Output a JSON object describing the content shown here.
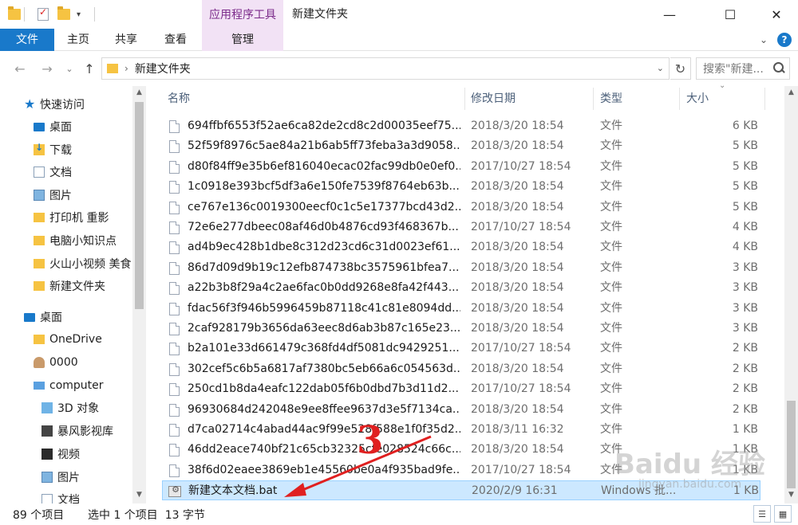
{
  "titlebar": {
    "context_tab": "应用程序工具",
    "window_title": "新建文件夹",
    "minimize": "—",
    "maximize": "☐",
    "close": "✕"
  },
  "ribbon": {
    "tabs": [
      "文件",
      "主页",
      "共享",
      "查看",
      "管理"
    ],
    "collapse": "⌄",
    "help": "?"
  },
  "address": {
    "back": "←",
    "forward": "→",
    "recent": "⌄",
    "up": "↑",
    "separator": "›",
    "path": "新建文件夹",
    "refresh": "↻",
    "search_placeholder": "搜索\"新建..."
  },
  "nav": {
    "items": [
      {
        "label": "快速访问",
        "icon": "star-icon"
      },
      {
        "label": "桌面",
        "icon": "desktop-folder-icon",
        "pinned": true
      },
      {
        "label": "下载",
        "icon": "download-icon",
        "pinned": true
      },
      {
        "label": "文档",
        "icon": "document-icon",
        "pinned": true
      },
      {
        "label": "图片",
        "icon": "picture-icon",
        "pinned": true
      },
      {
        "label": "打印机 重影",
        "icon": "folder-icon"
      },
      {
        "label": "电脑小知识点",
        "icon": "folder-icon"
      },
      {
        "label": "火山小视频 美食",
        "icon": "folder-icon"
      },
      {
        "label": "新建文件夹",
        "icon": "folder-icon"
      },
      {
        "label": "桌面",
        "icon": "desktop-icon"
      },
      {
        "label": "OneDrive",
        "icon": "onedrive-folder-icon"
      },
      {
        "label": "0000",
        "icon": "user-icon"
      },
      {
        "label": "computer",
        "icon": "computer-icon"
      },
      {
        "label": "3D 对象",
        "icon": "3d-objects-icon"
      },
      {
        "label": "暴风影视库",
        "icon": "video-library-icon"
      },
      {
        "label": "视频",
        "icon": "video-icon"
      },
      {
        "label": "图片",
        "icon": "picture-icon"
      },
      {
        "label": "文档",
        "icon": "document-icon"
      }
    ]
  },
  "columns": {
    "name": "名称",
    "date": "修改日期",
    "type": "类型",
    "size": "大小"
  },
  "files": [
    {
      "name": "694ffbf6553f52ae6ca82de2cd8c2d00035eef75...",
      "date": "2018/3/20 18:54",
      "type": "文件",
      "size": "6 KB"
    },
    {
      "name": "52f59f8976c5ae84a21b6ab5ff73feba3a3d9058...",
      "date": "2018/3/20 18:54",
      "type": "文件",
      "size": "5 KB"
    },
    {
      "name": "d80f84ff9e35b6ef816040ecac02fac99db0e0ef0...",
      "date": "2017/10/27 18:54",
      "type": "文件",
      "size": "5 KB"
    },
    {
      "name": "1c0918e393bcf5df3a6e150fe7539f8764eb63b...",
      "date": "2018/3/20 18:54",
      "type": "文件",
      "size": "5 KB"
    },
    {
      "name": "ce767e136c0019300eecf0c1c5e17377bcd43d2...",
      "date": "2018/3/20 18:54",
      "type": "文件",
      "size": "5 KB"
    },
    {
      "name": "72e6e277dbeec08af46d0b4876cd93f468367b...",
      "date": "2017/10/27 18:54",
      "type": "文件",
      "size": "4 KB"
    },
    {
      "name": "ad4b9ec428b1dbe8c312d23cd6c31d0023ef61...",
      "date": "2018/3/20 18:54",
      "type": "文件",
      "size": "4 KB"
    },
    {
      "name": "86d7d09d9b19c12efb874738bc3575961bfea7...",
      "date": "2018/3/20 18:54",
      "type": "文件",
      "size": "3 KB"
    },
    {
      "name": "a22b3b8f29a4c2ae6fac0b0dd9268e8fa42f443...",
      "date": "2018/3/20 18:54",
      "type": "文件",
      "size": "3 KB"
    },
    {
      "name": "fdac56f3f946b5996459b87118c41c81e8094dd...",
      "date": "2018/3/20 18:54",
      "type": "文件",
      "size": "3 KB"
    },
    {
      "name": "2caf928179b3656da63eec8d6ab3b87c165e23...",
      "date": "2018/3/20 18:54",
      "type": "文件",
      "size": "3 KB"
    },
    {
      "name": "b2a101e33d661479c368fd4df5081dc9429251...",
      "date": "2017/10/27 18:54",
      "type": "文件",
      "size": "2 KB"
    },
    {
      "name": "302cef5c6b5a6817af7380bc5eb66a6c054563d...",
      "date": "2018/3/20 18:54",
      "type": "文件",
      "size": "2 KB"
    },
    {
      "name": "250cd1b8da4eafc122dab05f6b0dbd7b3d11d2...",
      "date": "2017/10/27 18:54",
      "type": "文件",
      "size": "2 KB"
    },
    {
      "name": "96930684d242048e9ee8ffee9637d3e5f7134ca...",
      "date": "2018/3/20 18:54",
      "type": "文件",
      "size": "2 KB"
    },
    {
      "name": "d7ca02714c4abad44ac9f99e528f588e1f0f35d2...",
      "date": "2018/3/11 16:32",
      "type": "文件",
      "size": "1 KB"
    },
    {
      "name": "46dd2eace740bf21c65cb32325cfe028524c66c...",
      "date": "2018/3/20 18:54",
      "type": "文件",
      "size": "1 KB"
    },
    {
      "name": "38f6d02eaee3869eb1e45560be0a4f935bad9fe...",
      "date": "2017/10/27 18:54",
      "type": "文件",
      "size": "1 KB"
    },
    {
      "name": "新建文本文档.bat",
      "date": "2020/2/9 16:31",
      "type": "Windows 批...",
      "size": "1 KB",
      "selected": true
    }
  ],
  "status": {
    "count": "89 个项目",
    "selection": "选中 1 个项目  13 字节"
  },
  "annotation": {
    "number": "3",
    "color": "#e02020"
  },
  "watermark": {
    "brand": "Baidu 经验",
    "sub": "jingyan.baidu.com"
  },
  "colors": {
    "accent": "#1979ca",
    "context_tab_bg": "#f2e2f5",
    "selection_bg": "#cce8ff"
  }
}
